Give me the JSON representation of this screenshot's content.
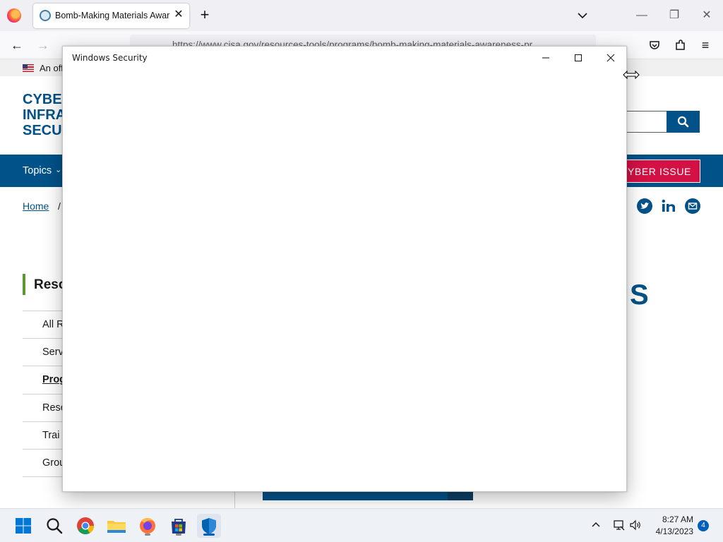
{
  "browser": {
    "tab": {
      "title": "Bomb-Making Materials Aware",
      "close_glyph": "✕"
    },
    "new_tab_glyph": "+",
    "url": "https://www.cisa.gov/resources-tools/programs/bomb-making-materials-awareness-pr",
    "window_controls": {
      "minimize": "—",
      "restore": "❐",
      "close": "✕"
    },
    "nav": {
      "back": "←",
      "forward": "→",
      "reload": "↻",
      "menu": "≡"
    }
  },
  "page": {
    "banner_text": "An off",
    "logo_lines": [
      "CYBER",
      "INFRA",
      "SECUR"
    ],
    "topics_label": "Topics",
    "topics_chevron": "⌄",
    "report_label": "YBER ISSUE",
    "breadcrumb": {
      "home": "Home",
      "separator": "/"
    },
    "sidebar": {
      "heading": "Reso",
      "items": [
        "All R",
        "Serv",
        "Prog",
        "Reso",
        "Trai",
        "Grou"
      ]
    },
    "heading_fragment": "S"
  },
  "dialog": {
    "title": "Windows Security"
  },
  "taskbar": {
    "clock": {
      "time": "8:27 AM",
      "date": "4/13/2023"
    },
    "notification_count": "4"
  },
  "colors": {
    "brand_blue": "#005288",
    "report_red": "#d31145",
    "sidebar_accent": "#5e9732",
    "taskbar_accent": "#005fb8"
  }
}
